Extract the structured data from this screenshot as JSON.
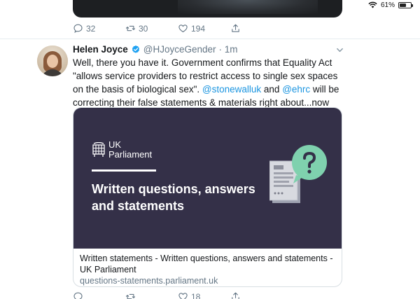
{
  "status_bar": {
    "battery_text": "61%",
    "battery_level": 0.61,
    "icons": [
      "wifi-icon",
      "battery-icon"
    ]
  },
  "prev_tweet": {
    "actions": {
      "reply_count": "32",
      "retweet_count": "30",
      "like_count": "194"
    }
  },
  "tweet": {
    "author_name": "Helen Joyce",
    "handle": "@HJoyceGender",
    "time": "· 1m",
    "text_part1": "Well, there you have it. Government confirms that Equality Act \"allows service providers to restrict access to single sex spaces on the basis of biological sex\". ",
    "mention1": "@stonewalluk",
    "text_part2": " and ",
    "mention2": "@ehrc",
    "text_part3": " will be correcting their false statements & materials right about...now",
    "card": {
      "logo_text_line1": "UK",
      "logo_text_line2": "Parliament",
      "image_title": "Written questions, answers and statements",
      "meta_title": "Written statements - Written questions, answers and statements - UK Parliament",
      "meta_url": "questions-statements.parliament.uk"
    },
    "actions": {
      "reply_count": "",
      "retweet_count": "",
      "like_count": "18"
    }
  },
  "colors": {
    "link": "#1b95e0",
    "secondary_text": "#657786",
    "card_background": "#343048",
    "illustration_accent": "#7fd1ae"
  }
}
